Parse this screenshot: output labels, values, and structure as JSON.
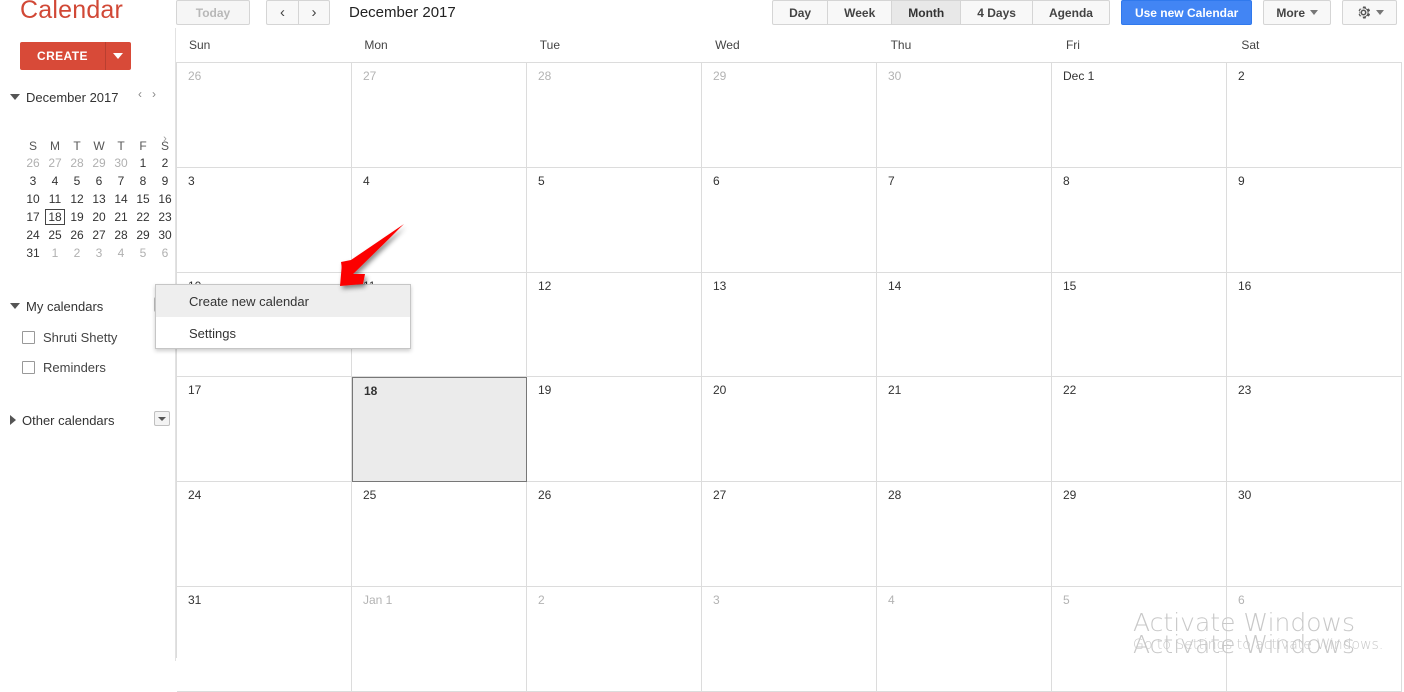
{
  "app": {
    "brand": "Calendar"
  },
  "toolbar": {
    "today_label": "Today",
    "prev_icon": "‹",
    "next_icon": "›",
    "date_title": "December 2017",
    "views": [
      {
        "label": "Day",
        "selected": false
      },
      {
        "label": "Week",
        "selected": false
      },
      {
        "label": "Month",
        "selected": true
      },
      {
        "label": "4 Days",
        "selected": false
      },
      {
        "label": "Agenda",
        "selected": false
      }
    ],
    "use_new_calendar_label": "Use new Calendar",
    "more_label": "More",
    "gear_icon": "gear-icon",
    "accent_blue": "#4285f4",
    "accent_red": "#d84a38"
  },
  "sidebar": {
    "create_label": "CREATE",
    "mini_calendar": {
      "title": "December 2017",
      "prev_icon": "‹",
      "next_icon": "›",
      "weekday_initials": [
        "S",
        "M",
        "T",
        "W",
        "T",
        "F",
        "S"
      ],
      "weeks": [
        [
          {
            "d": "26",
            "muted": true
          },
          {
            "d": "27",
            "muted": true
          },
          {
            "d": "28",
            "muted": true
          },
          {
            "d": "29",
            "muted": true
          },
          {
            "d": "30",
            "muted": true
          },
          {
            "d": "1",
            "muted": false
          },
          {
            "d": "2",
            "muted": false
          }
        ],
        [
          {
            "d": "3",
            "muted": false
          },
          {
            "d": "4",
            "muted": false
          },
          {
            "d": "5",
            "muted": false
          },
          {
            "d": "6",
            "muted": false
          },
          {
            "d": "7",
            "muted": false
          },
          {
            "d": "8",
            "muted": false
          },
          {
            "d": "9",
            "muted": false
          }
        ],
        [
          {
            "d": "10",
            "muted": false
          },
          {
            "d": "11",
            "muted": false
          },
          {
            "d": "12",
            "muted": false
          },
          {
            "d": "13",
            "muted": false
          },
          {
            "d": "14",
            "muted": false
          },
          {
            "d": "15",
            "muted": false
          },
          {
            "d": "16",
            "muted": false
          }
        ],
        [
          {
            "d": "17",
            "muted": false
          },
          {
            "d": "18",
            "muted": false,
            "today": true
          },
          {
            "d": "19",
            "muted": false
          },
          {
            "d": "20",
            "muted": false
          },
          {
            "d": "21",
            "muted": false
          },
          {
            "d": "22",
            "muted": false
          },
          {
            "d": "23",
            "muted": false
          }
        ],
        [
          {
            "d": "24",
            "muted": false
          },
          {
            "d": "25",
            "muted": false
          },
          {
            "d": "26",
            "muted": false
          },
          {
            "d": "27",
            "muted": false
          },
          {
            "d": "28",
            "muted": false
          },
          {
            "d": "29",
            "muted": false
          },
          {
            "d": "30",
            "muted": false
          }
        ],
        [
          {
            "d": "31",
            "muted": false
          },
          {
            "d": "1",
            "muted": true
          },
          {
            "d": "2",
            "muted": true
          },
          {
            "d": "3",
            "muted": true
          },
          {
            "d": "4",
            "muted": true
          },
          {
            "d": "5",
            "muted": true
          },
          {
            "d": "6",
            "muted": true
          }
        ]
      ]
    },
    "my_calendars": {
      "label": "My calendars",
      "items": [
        {
          "label": "Shruti Shetty",
          "checked": false
        },
        {
          "label": "Reminders",
          "checked": false
        }
      ]
    },
    "other_calendars": {
      "label": "Other calendars"
    },
    "collapse_icon": "›"
  },
  "calendar_menu": {
    "open": true,
    "items": [
      {
        "label": "Create new calendar",
        "hovered": true
      },
      {
        "label": "Settings",
        "hovered": false
      }
    ]
  },
  "grid": {
    "day_names": [
      "Sun",
      "Mon",
      "Tue",
      "Wed",
      "Thu",
      "Fri",
      "Sat"
    ],
    "weeks": [
      [
        {
          "label": "26",
          "muted": true
        },
        {
          "label": "27",
          "muted": true
        },
        {
          "label": "28",
          "muted": true
        },
        {
          "label": "29",
          "muted": true
        },
        {
          "label": "30",
          "muted": true
        },
        {
          "label": "Dec 1",
          "muted": false
        },
        {
          "label": "2",
          "muted": false
        }
      ],
      [
        {
          "label": "3",
          "muted": false
        },
        {
          "label": "4",
          "muted": false
        },
        {
          "label": "5",
          "muted": false
        },
        {
          "label": "6",
          "muted": false
        },
        {
          "label": "7",
          "muted": false
        },
        {
          "label": "8",
          "muted": false
        },
        {
          "label": "9",
          "muted": false
        }
      ],
      [
        {
          "label": "10",
          "muted": false
        },
        {
          "label": "11",
          "muted": false
        },
        {
          "label": "12",
          "muted": false
        },
        {
          "label": "13",
          "muted": false
        },
        {
          "label": "14",
          "muted": false
        },
        {
          "label": "15",
          "muted": false
        },
        {
          "label": "16",
          "muted": false
        }
      ],
      [
        {
          "label": "17",
          "muted": false
        },
        {
          "label": "18",
          "muted": false,
          "today": true
        },
        {
          "label": "19",
          "muted": false
        },
        {
          "label": "20",
          "muted": false
        },
        {
          "label": "21",
          "muted": false
        },
        {
          "label": "22",
          "muted": false
        },
        {
          "label": "23",
          "muted": false
        }
      ],
      [
        {
          "label": "24",
          "muted": false
        },
        {
          "label": "25",
          "muted": false
        },
        {
          "label": "26",
          "muted": false
        },
        {
          "label": "27",
          "muted": false
        },
        {
          "label": "28",
          "muted": false
        },
        {
          "label": "29",
          "muted": false
        },
        {
          "label": "30",
          "muted": false
        }
      ],
      [
        {
          "label": "31",
          "muted": false
        },
        {
          "label": "Jan 1",
          "muted": true
        },
        {
          "label": "2",
          "muted": true
        },
        {
          "label": "3",
          "muted": true
        },
        {
          "label": "4",
          "muted": true
        },
        {
          "label": "5",
          "muted": true
        },
        {
          "label": "6",
          "muted": true
        }
      ]
    ]
  },
  "annotation": {
    "arrow_color": "#fc0000"
  },
  "watermark": {
    "title": "Activate Windows",
    "subtitle": "Go to Settings to activate Windows."
  }
}
